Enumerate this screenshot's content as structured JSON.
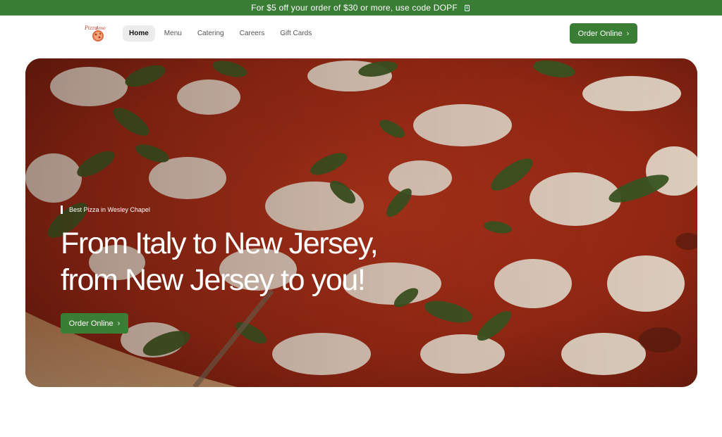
{
  "promo": {
    "text": "For $5 off your order of $30 or more, use code DOPF",
    "icon": "copy-icon"
  },
  "header": {
    "logo_alt": "logo",
    "nav": [
      {
        "label": "Home",
        "active": true
      },
      {
        "label": "Menu"
      },
      {
        "label": "Catering"
      },
      {
        "label": "Careers"
      },
      {
        "label": "Gift Cards"
      }
    ],
    "order_label": "Order Online",
    "order_icon": "chevron-right-icon"
  },
  "hero": {
    "tagline": "Best Pizza in Wesley Chapel",
    "title_line1": "From Italy to New Jersey,",
    "title_line2": "from New Jersey to you!",
    "order_label": "Order Online",
    "background": "pizza-photo"
  },
  "colors": {
    "brand_green": "#3a7d35",
    "white": "#ffffff"
  }
}
